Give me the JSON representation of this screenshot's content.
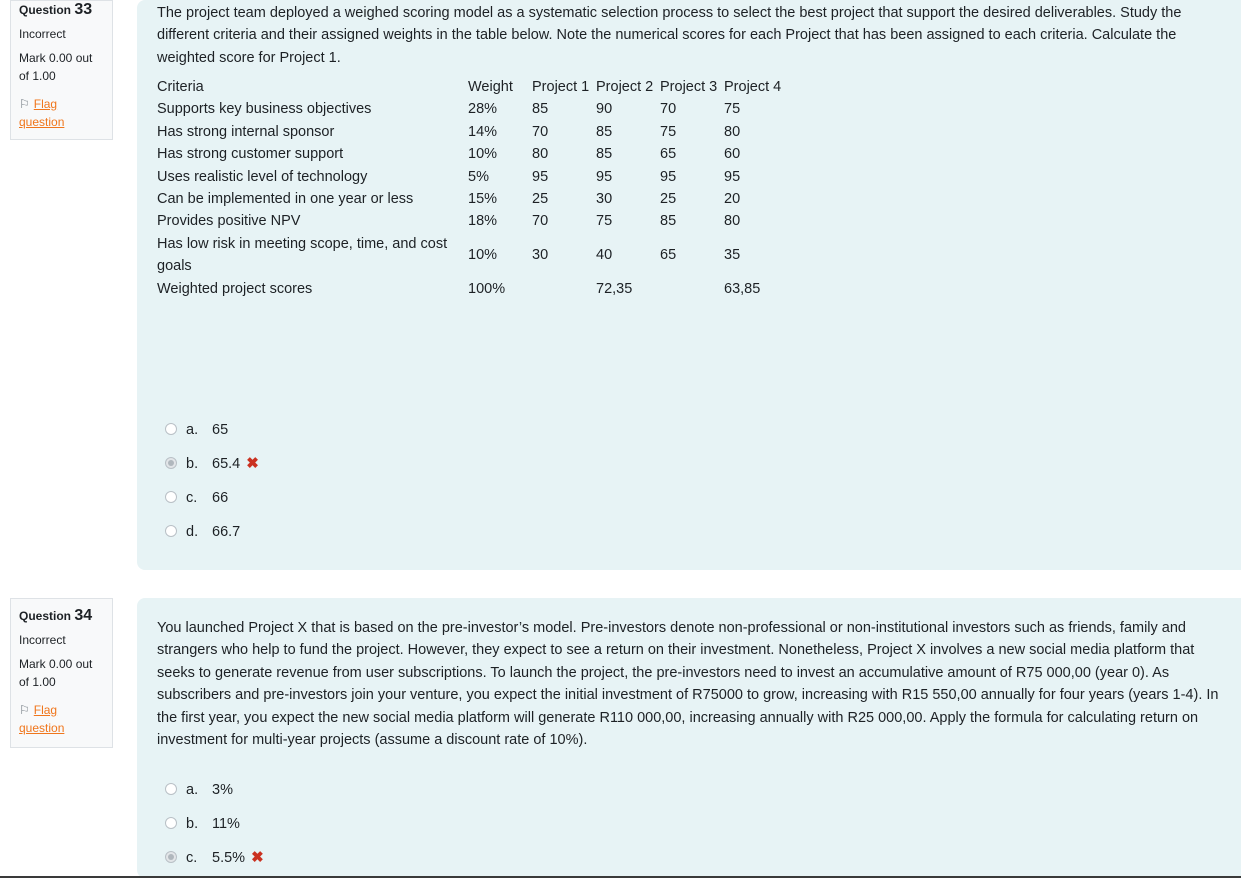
{
  "q33": {
    "question_label": "Question",
    "question_number": "33",
    "state": "Incorrect",
    "grade": "Mark 0.00 out of 1.00",
    "flag_label": "Flag question",
    "text": "The project team deployed a weighed scoring model as a systematic selection process to select the best project that support the desired deliverables. Study the different criteria and their assigned weights in the table below. Note the numerical scores for each Project that has been assigned to each criteria. Calculate the weighted score for Project 1.",
    "table": {
      "headers": [
        "Criteria",
        "Weight",
        "Project 1",
        "Project 2",
        "Project 3",
        "Project 4"
      ],
      "rows": [
        [
          "Supports key business objectives",
          "28%",
          "85",
          "90",
          "70",
          "75"
        ],
        [
          "Has strong internal sponsor",
          "14%",
          "70",
          "85",
          "75",
          "80"
        ],
        [
          "Has strong customer support",
          "10%",
          "80",
          "85",
          "65",
          "60"
        ],
        [
          "Uses realistic level of technology",
          "5%",
          "95",
          "95",
          "95",
          "95"
        ],
        [
          "Can be implemented in one year or less",
          "15%",
          "25",
          "30",
          "25",
          "20"
        ],
        [
          "Provides positive NPV",
          "18%",
          "70",
          "75",
          "85",
          "80"
        ],
        [
          "Has low risk in meeting scope, time, and cost goals",
          "10%",
          "30",
          "40",
          "65",
          "35"
        ],
        [
          "Weighted project scores",
          "100%",
          "",
          "72,35",
          "",
          "63,85"
        ]
      ]
    },
    "answers": [
      {
        "letter": "a.",
        "text": "65",
        "selected": false,
        "incorrect": false
      },
      {
        "letter": "b.",
        "text": "65.4",
        "selected": true,
        "incorrect": true
      },
      {
        "letter": "c.",
        "text": "66",
        "selected": false,
        "incorrect": false
      },
      {
        "letter": "d.",
        "text": "66.7",
        "selected": false,
        "incorrect": false
      }
    ]
  },
  "q34": {
    "question_label": "Question",
    "question_number": "34",
    "state": "Incorrect",
    "grade": "Mark 0.00 out of 1.00",
    "flag_label": "Flag question",
    "text": "You launched Project X that is based on the pre-investor’s model. Pre-investors denote non-professional or non-institutional investors such as friends, family and strangers who help to fund the project. However, they expect to see a return on their investment. Nonetheless, Project X involves a new social media platform that seeks to generate revenue from user subscriptions. To launch the project, the pre-investors need to invest an accumulative amount of R75 000,00 (year 0). As subscribers and pre-investors join your venture, you expect the initial investment of R75000 to grow, increasing with R15 550,00 annually for four years (years 1-4). In the first year, you expect the new social media platform will generate R110 000,00, increasing annually with R25 000,00. Apply the formula for calculating return on investment for multi-year projects (assume a discount rate of 10%).",
    "answers": [
      {
        "letter": "a.",
        "text": "3%",
        "selected": false,
        "incorrect": false
      },
      {
        "letter": "b.",
        "text": "11%",
        "selected": false,
        "incorrect": false
      },
      {
        "letter": "c.",
        "text": "5.5%",
        "selected": true,
        "incorrect": true
      }
    ]
  },
  "icons": {
    "flag": "flag-icon",
    "incorrect": "cross-icon"
  },
  "colors": {
    "content_bg": "#e7f3f5",
    "flag_link": "#f0761c",
    "incorrect_mark": "#ca3120"
  }
}
